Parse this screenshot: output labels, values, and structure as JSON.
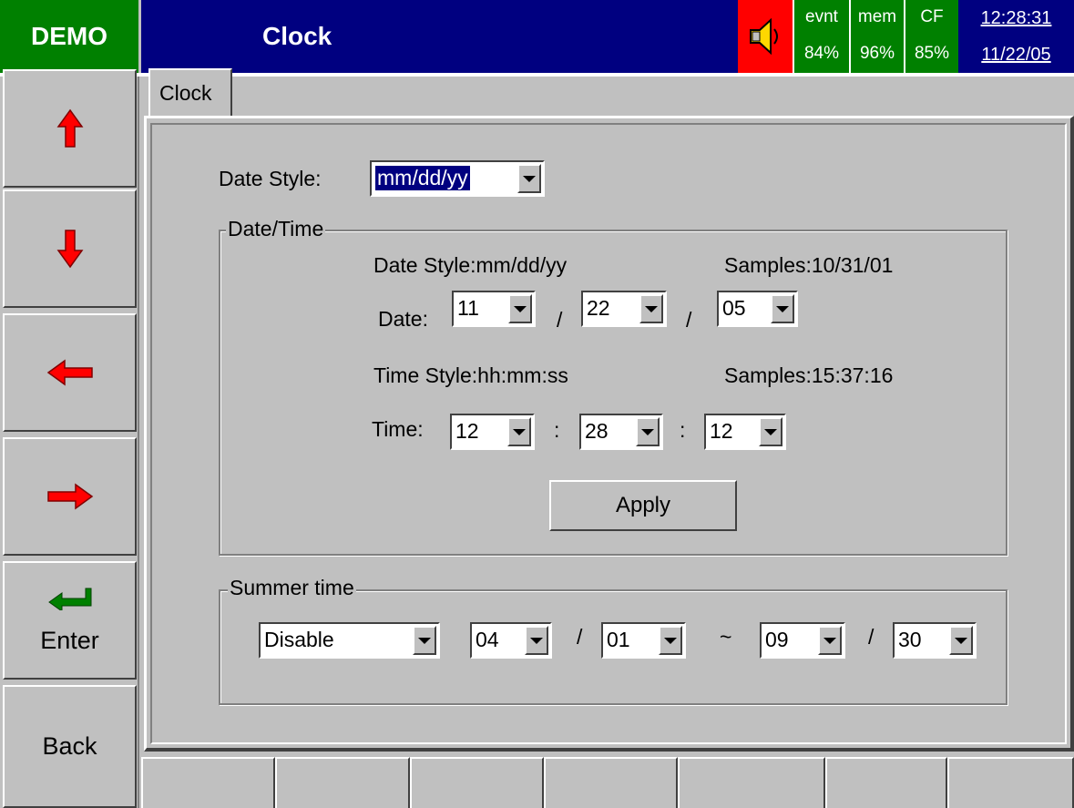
{
  "header": {
    "mode": "DEMO",
    "title": "Clock",
    "status": [
      {
        "label": "evnt",
        "value": "84%"
      },
      {
        "label": "mem",
        "value": "96%"
      },
      {
        "label": "CF",
        "value": "85%"
      }
    ],
    "time": "12:28:31",
    "date": "11/22/05"
  },
  "sidebar": {
    "enter_label": "Enter",
    "back_label": "Back"
  },
  "tab": {
    "label": "Clock"
  },
  "date_style": {
    "label": "Date Style:",
    "value": "mm/dd/yy"
  },
  "datetime_group": {
    "title": "Date/Time",
    "date_style_info": "Date Style:mm/dd/yy",
    "date_samples": "Samples:10/31/01",
    "date_label": "Date:",
    "date_month": "11",
    "date_day": "22",
    "date_year": "05",
    "date_sep": "/",
    "time_style_info": "Time Style:hh:mm:ss",
    "time_samples": "Samples:15:37:16",
    "time_label": "Time:",
    "time_hour": "12",
    "time_min": "28",
    "time_sec": "12",
    "time_sep": ":",
    "apply_label": "Apply"
  },
  "summer_group": {
    "title": "Summer time",
    "mode": "Disable",
    "start_month": "04",
    "start_day": "01",
    "range_sep": "~",
    "end_month": "09",
    "end_day": "30",
    "sep": "/"
  },
  "colors": {
    "demo_bg": "#008000",
    "title_bg": "#000080",
    "speaker_bg": "#ff0000",
    "arrow_red": "#ff0000",
    "enter_green": "#008000"
  }
}
